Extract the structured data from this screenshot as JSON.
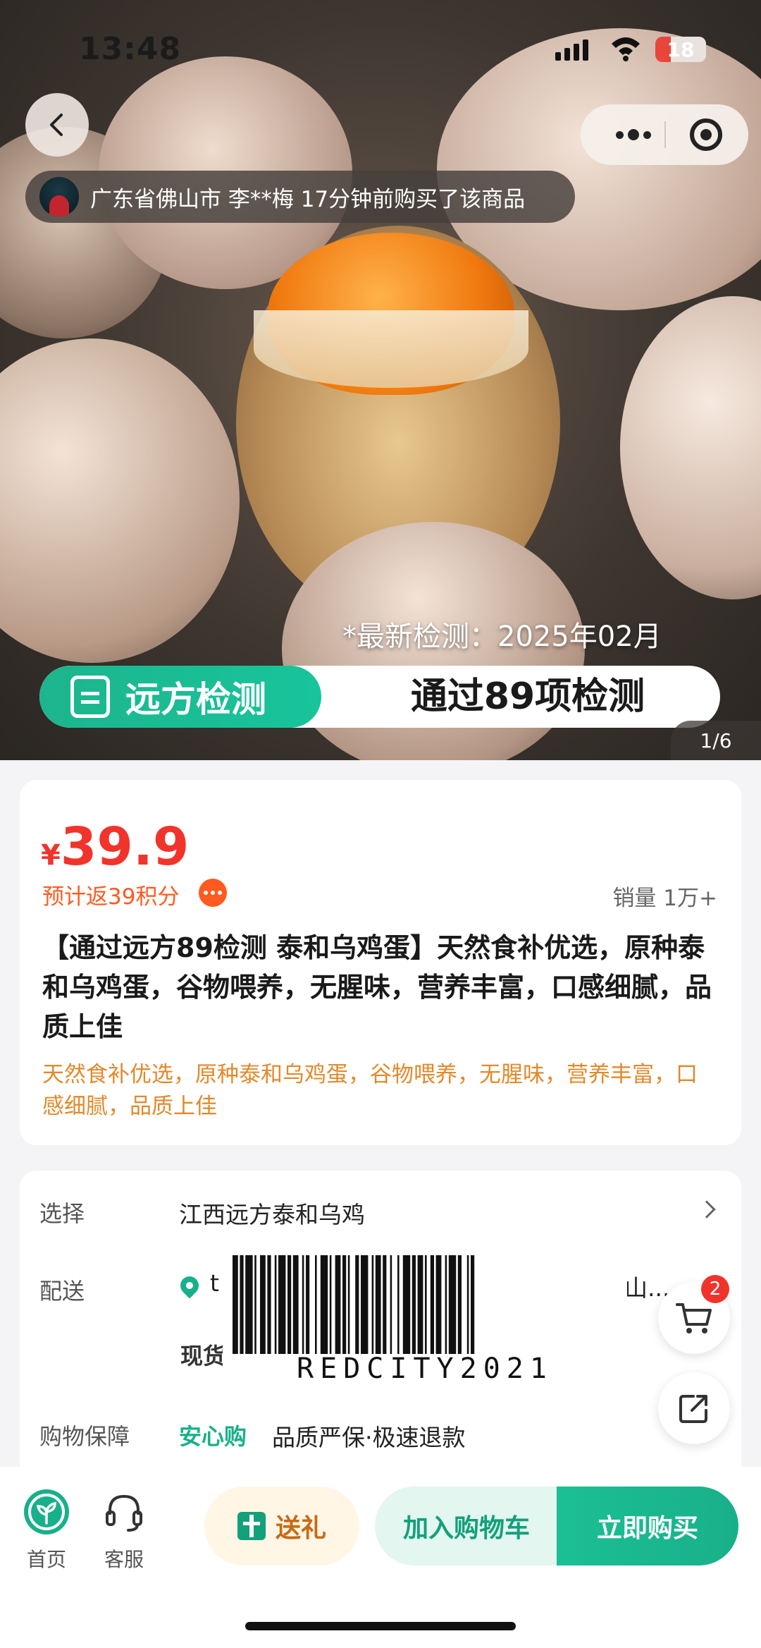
{
  "status_bar": {
    "time": "13:48",
    "battery": "18"
  },
  "hero": {
    "buyer_notice": "广东省佛山市  李**梅  17分钟前购买了该商品",
    "test_date": "*最新检测：2025年02月",
    "test_brand": "远方检测",
    "test_result": "通过89项检测",
    "page_indicator": "1/6"
  },
  "product": {
    "price_symbol": "¥",
    "price": "39.9",
    "points": "预计返39积分",
    "sales": "销量 1万+",
    "title": "【通过远方89检测 泰和乌鸡蛋】天然食补优选，原种泰和乌鸡蛋，谷物喂养，无腥味，营养丰富，口感细腻，品质上佳",
    "subtitle": "天然食补优选，原种泰和乌鸡蛋，谷物喂养，无腥味，营养丰富，口感细腻，品质上佳"
  },
  "options": {
    "select_label": "选择",
    "select_value": "江西远方泰和乌鸡",
    "delivery_label": "配送",
    "delivery_value": "t",
    "delivery_value_end": "山...",
    "stock": "现货",
    "guarantee_label": "购物保障",
    "guarantee_tag": "安心购",
    "guarantee_value": "品质严保·极速退款"
  },
  "overlay": {
    "barcode_text": "REDCITY2021"
  },
  "floating": {
    "cart_count": "2"
  },
  "bottom_bar": {
    "home_label": "首页",
    "service_label": "客服",
    "gift_label": "送礼",
    "add_cart_label": "加入购物车",
    "buy_now_label": "立即购买"
  },
  "colors": {
    "accent": "#18b08a",
    "price": "#f0342c",
    "subtitle": "#e2892a"
  }
}
